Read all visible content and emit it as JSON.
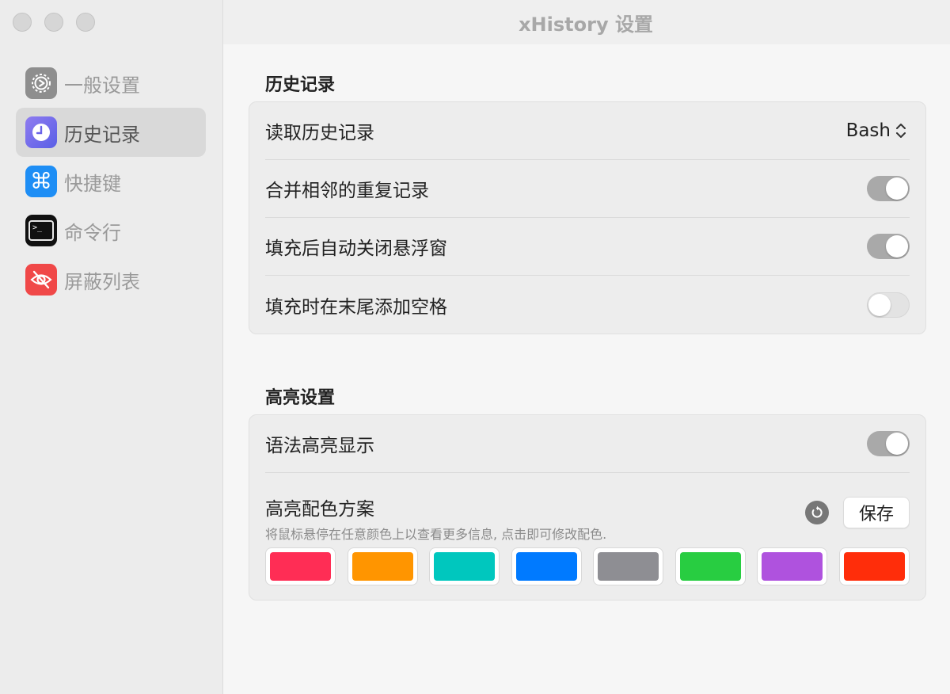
{
  "window": {
    "title": "xHistory 设置"
  },
  "sidebar": {
    "items": [
      {
        "label": "一般设置",
        "icon": "gear-icon",
        "color": "#8e8e8e"
      },
      {
        "label": "历史记录",
        "icon": "clock-icon",
        "color": "#6e6ef0"
      },
      {
        "label": "快捷键",
        "icon": "command-icon",
        "color": "#1e8ef5"
      },
      {
        "label": "命令行",
        "icon": "terminal-icon",
        "color": "#111111"
      },
      {
        "label": "屏蔽列表",
        "icon": "eye-slash-icon",
        "color": "#f04848"
      }
    ],
    "active_index": 1
  },
  "history": {
    "section_title": "历史记录",
    "read_history": {
      "label": "读取历史记录",
      "value": "Bash"
    },
    "merge_duplicates": {
      "label": "合并相邻的重复记录",
      "on": true
    },
    "auto_close": {
      "label": "填充后自动关闭悬浮窗",
      "on": true
    },
    "add_space": {
      "label": "填充时在末尾添加空格",
      "on": false
    }
  },
  "highlight": {
    "section_title": "高亮设置",
    "syntax": {
      "label": "语法高亮显示",
      "on": true
    },
    "scheme": {
      "label": "高亮配色方案",
      "hint": "将鼠标悬停在任意颜色上以查看更多信息, 点击即可修改配色.",
      "save_label": "保存",
      "colors": [
        "#ff2d55",
        "#ff9500",
        "#00c7be",
        "#007aff",
        "#8e8e93",
        "#28cd41",
        "#af52de",
        "#ff2d0a"
      ]
    }
  }
}
